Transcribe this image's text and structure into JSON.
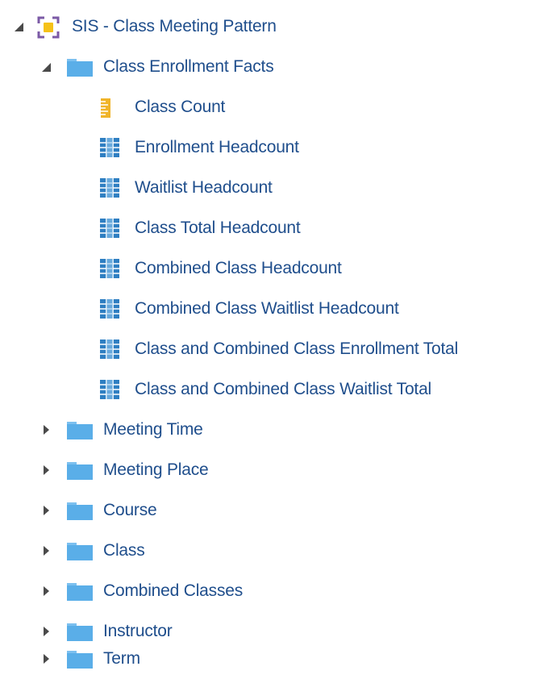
{
  "colors": {
    "text": "#1f4e8c",
    "folder": "#5aaee8",
    "folder_tab": "#7cc0ef",
    "toggle": "#4a4a4a",
    "subject_area_frame": "#7b5aa6",
    "subject_area_core": "#f5c118",
    "measure_gold": "#f0b429",
    "column_grid": "#2f7fc2"
  },
  "tree": {
    "root": {
      "label": "SIS - Class Meeting Pattern",
      "icon": "subject-area-icon",
      "expanded": true
    },
    "folders": [
      {
        "label": "Class Enrollment Facts",
        "icon": "folder-icon",
        "expanded": true,
        "children": [
          {
            "label": "Class Count",
            "icon": "measure-ruler-icon"
          },
          {
            "label": "Enrollment Headcount",
            "icon": "column-grid-icon"
          },
          {
            "label": "Waitlist Headcount",
            "icon": "column-grid-icon"
          },
          {
            "label": "Class Total Headcount",
            "icon": "column-grid-icon"
          },
          {
            "label": "Combined Class Headcount",
            "icon": "column-grid-icon"
          },
          {
            "label": "Combined Class Waitlist Headcount",
            "icon": "column-grid-icon"
          },
          {
            "label": "Class and Combined Class Enrollment Total",
            "icon": "column-grid-icon"
          },
          {
            "label": "Class and Combined Class Waitlist Total",
            "icon": "column-grid-icon"
          }
        ]
      },
      {
        "label": "Meeting Time",
        "icon": "folder-icon",
        "expanded": false
      },
      {
        "label": "Meeting Place",
        "icon": "folder-icon",
        "expanded": false
      },
      {
        "label": "Course",
        "icon": "folder-icon",
        "expanded": false
      },
      {
        "label": "Class",
        "icon": "folder-icon",
        "expanded": false
      },
      {
        "label": "Combined Classes",
        "icon": "folder-icon",
        "expanded": false
      },
      {
        "label": "Instructor",
        "icon": "folder-icon",
        "expanded": false
      },
      {
        "label": "Term",
        "icon": "folder-icon",
        "expanded": false
      }
    ]
  }
}
